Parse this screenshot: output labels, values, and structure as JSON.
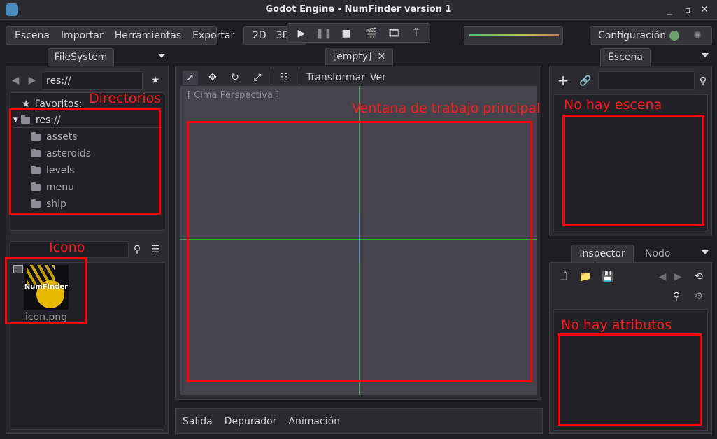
{
  "window": {
    "title": "Godot Engine - NumFinder version 1",
    "controls": [
      "minimize",
      "maximize",
      "close"
    ]
  },
  "menu": {
    "items": [
      "Escena",
      "Importar",
      "Herramientas",
      "Exportar"
    ]
  },
  "mode": {
    "label_2d": "2D",
    "label_3d": "3D"
  },
  "top_right": {
    "settings_label": "Configuración"
  },
  "filesystem": {
    "tab_label": "FileSystem",
    "path_value": "res://",
    "favorites_label": "Favoritos:",
    "root_label": "res://",
    "folders": [
      "assets",
      "asteroids",
      "levels",
      "menu",
      "ship"
    ],
    "search_value": "",
    "file_name": "icon.png",
    "icon_text": "NumFinder"
  },
  "viewport": {
    "tab_label": "[empty]",
    "transform_label": "Transformar",
    "view_label": "Ver",
    "perspective_label": "[ Cima Perspectiva ]"
  },
  "bottom": {
    "tabs": [
      "Salida",
      "Depurador",
      "Animación"
    ]
  },
  "scene": {
    "tab_label": "Escena",
    "filter_value": ""
  },
  "inspector": {
    "tab_inspector": "Inspector",
    "tab_node": "Nodo"
  },
  "annotations": {
    "directories": "Directorios",
    "icon": "Icono",
    "main_window": "Ventana de trabajo principal",
    "no_scene": "No hay escena",
    "no_attributes": "No hay atributos"
  },
  "colors": {
    "annotation": "#ff0000",
    "axis_x": "#3fa33f",
    "accent": "#6ba0d8"
  }
}
